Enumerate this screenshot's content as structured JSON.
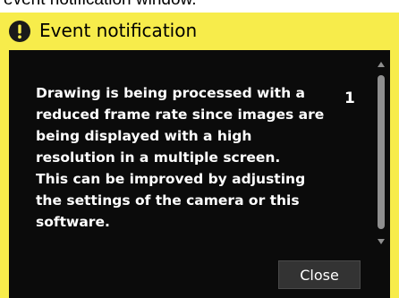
{
  "caption": "event notification window.",
  "dialog": {
    "title": "Event notification",
    "title_icon": "exclamation-circle-icon",
    "header_color": "#f7ec4b",
    "body_color": "#0b0b0b",
    "message": "Drawing is being processed with a\nreduced frame rate since images are\nbeing displayed with a high\nresolution in a multiple screen.\nThis can be improved by adjusting\nthe settings of the camera or this\nsoftware.",
    "count": "1",
    "close_label": "Close"
  }
}
